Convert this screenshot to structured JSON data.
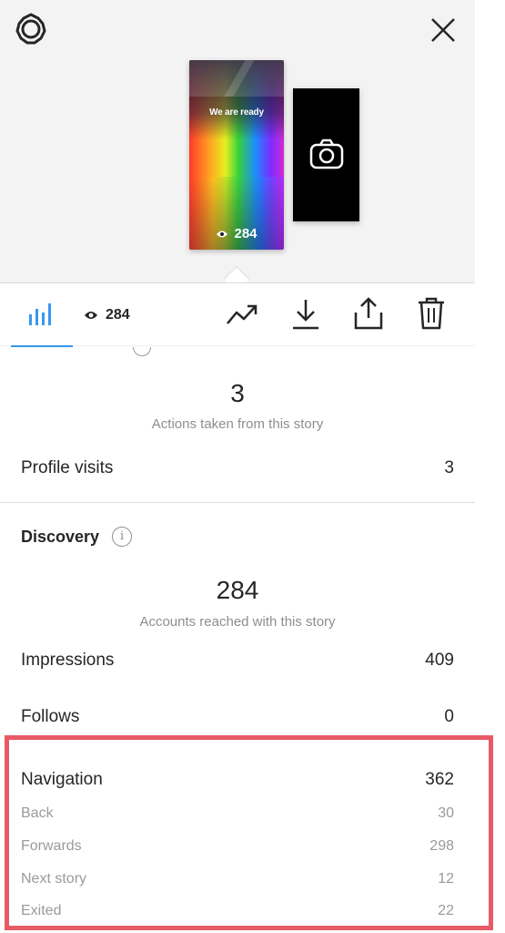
{
  "story_preview": {
    "caption": "We are ready",
    "view_count": "284"
  },
  "toolbar": {
    "views_count": "284"
  },
  "interactions": {
    "actions_value": "3",
    "actions_label": "Actions taken from this story",
    "profile_visits_label": "Profile visits",
    "profile_visits_value": "3"
  },
  "discovery": {
    "title": "Discovery",
    "reach_value": "284",
    "reach_label": "Accounts reached with this story",
    "impressions_label": "Impressions",
    "impressions_value": "409",
    "follows_label": "Follows",
    "follows_value": "0"
  },
  "navigation": {
    "label": "Navigation",
    "value": "362",
    "items": [
      {
        "label": "Back",
        "value": "30"
      },
      {
        "label": "Forwards",
        "value": "298"
      },
      {
        "label": "Next story",
        "value": "12"
      },
      {
        "label": "Exited",
        "value": "22"
      }
    ]
  },
  "colors": {
    "accent": "#3897f0",
    "highlight_border": "#e85a66",
    "muted_text": "#8e8e8e"
  },
  "icons": [
    "gear-icon",
    "close-icon",
    "camera-icon",
    "eye-icon",
    "bar-chart-icon",
    "trending-icon",
    "download-icon",
    "share-icon",
    "trash-icon",
    "info-icon"
  ]
}
